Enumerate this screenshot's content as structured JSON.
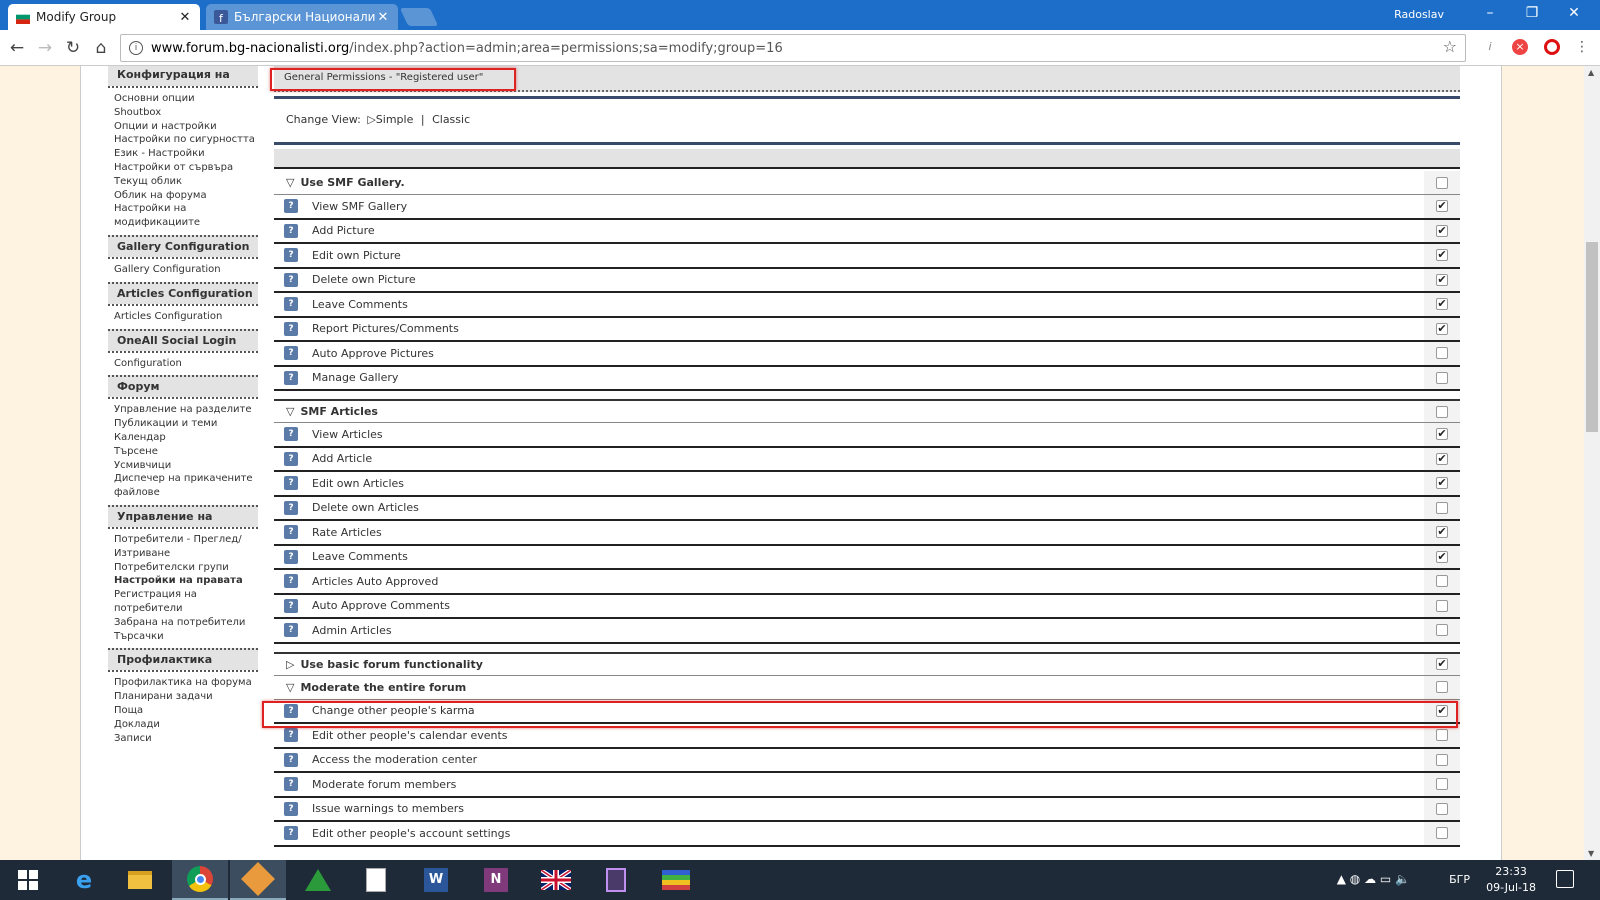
{
  "browser": {
    "tabs": [
      {
        "title": "Modify Group",
        "active": true
      },
      {
        "title": "Български Националист",
        "active": false
      }
    ],
    "user": "Radoslav",
    "url_domain": "www.forum.bg-nacionalisti.org",
    "url_path": "/index.php?action=admin;area=permissions;sa=modify;group=16"
  },
  "sidebar": {
    "sections": [
      {
        "title": "Конфигурация на",
        "items": [
          "Основни опции",
          "Shoutbox",
          "Опции и настройки",
          "Настройки по сигурността",
          "Език - Настройки",
          "Настройки от сървъра",
          "Текущ облик",
          "Облик на форума",
          "Настройки на модификациите"
        ]
      },
      {
        "title": "Gallery Configuration",
        "items": [
          "Gallery Configuration"
        ]
      },
      {
        "title": "Articles Configuration",
        "items": [
          "Articles Configuration"
        ]
      },
      {
        "title": "OneAll Social Login",
        "items": [
          "Configuration"
        ]
      },
      {
        "title": "Форум",
        "items": [
          "Управление на разделите",
          "Публикации и теми",
          "Календар",
          "Търсене",
          "Усмивчици",
          "Диспечер на прикачените файлове"
        ]
      },
      {
        "title": "Управление на",
        "items": [
          "Потребители - Преглед/ Изтриване",
          "Потребителски групи",
          "Настройки на правата",
          "Регистрация на потребители",
          "Забрана на потребители",
          "Търсачки"
        ],
        "bold_item": "Настройки на правата"
      },
      {
        "title": "Профилактика",
        "items": [
          "Профилактика на форума",
          "Планирани задачи",
          "Поща",
          "Доклади",
          "Записи"
        ]
      }
    ]
  },
  "main": {
    "title": "General Permissions - \"Registered user\"",
    "change_view_label": "Change View:",
    "view_simple": "Simple",
    "view_sep": "|",
    "view_classic": "Classic",
    "groups": [
      {
        "title": "Use SMF Gallery.",
        "expanded": true,
        "checked": false,
        "items": [
          {
            "label": "View SMF Gallery",
            "checked": true
          },
          {
            "label": "Add Picture",
            "checked": true
          },
          {
            "label": "Edit own Picture",
            "checked": true
          },
          {
            "label": "Delete own Picture",
            "checked": true
          },
          {
            "label": "Leave Comments",
            "checked": true
          },
          {
            "label": "Report Pictures/Comments",
            "checked": true
          },
          {
            "label": "Auto Approve Pictures",
            "checked": false
          },
          {
            "label": "Manage Gallery",
            "checked": false
          }
        ]
      },
      {
        "title": "SMF Articles",
        "expanded": true,
        "checked": false,
        "items": [
          {
            "label": "View Articles",
            "checked": true
          },
          {
            "label": "Add Article",
            "checked": true
          },
          {
            "label": "Edit own Articles",
            "checked": true
          },
          {
            "label": "Delete own Articles",
            "checked": false
          },
          {
            "label": "Rate Articles",
            "checked": true
          },
          {
            "label": "Leave Comments",
            "checked": true
          },
          {
            "label": "Articles Auto Approved",
            "checked": false
          },
          {
            "label": "Auto Approve Comments",
            "checked": false
          },
          {
            "label": "Admin Articles",
            "checked": false
          }
        ]
      },
      {
        "title": "Use basic forum functionality",
        "expanded": false,
        "checked": true,
        "items": []
      },
      {
        "title": "Moderate the entire forum",
        "expanded": true,
        "checked": false,
        "items": [
          {
            "label": "Change other people's karma",
            "checked": true
          },
          {
            "label": "Edit other people's calendar events",
            "checked": false
          },
          {
            "label": "Access the moderation center",
            "checked": false
          },
          {
            "label": "Moderate forum members",
            "checked": false
          },
          {
            "label": "Issue warnings to members",
            "checked": false
          },
          {
            "label": "Edit other people's account settings",
            "checked": false
          }
        ]
      }
    ]
  },
  "taskbar": {
    "apps": [
      "start-icon",
      "edge-icon",
      "explorer-icon",
      "chrome-icon",
      "faststone-icon",
      "app-icon",
      "notepad-icon",
      "word-icon",
      "onenote-icon",
      "uk-flag-icon",
      "app2-icon",
      "winrar-icon"
    ],
    "lang": "БГР",
    "time": "23:33",
    "date": "09-Jul-18"
  },
  "colors": {
    "accent": "#1d6ec9",
    "highlight": "#dd2222",
    "header_bg": "#e3e3e3"
  }
}
